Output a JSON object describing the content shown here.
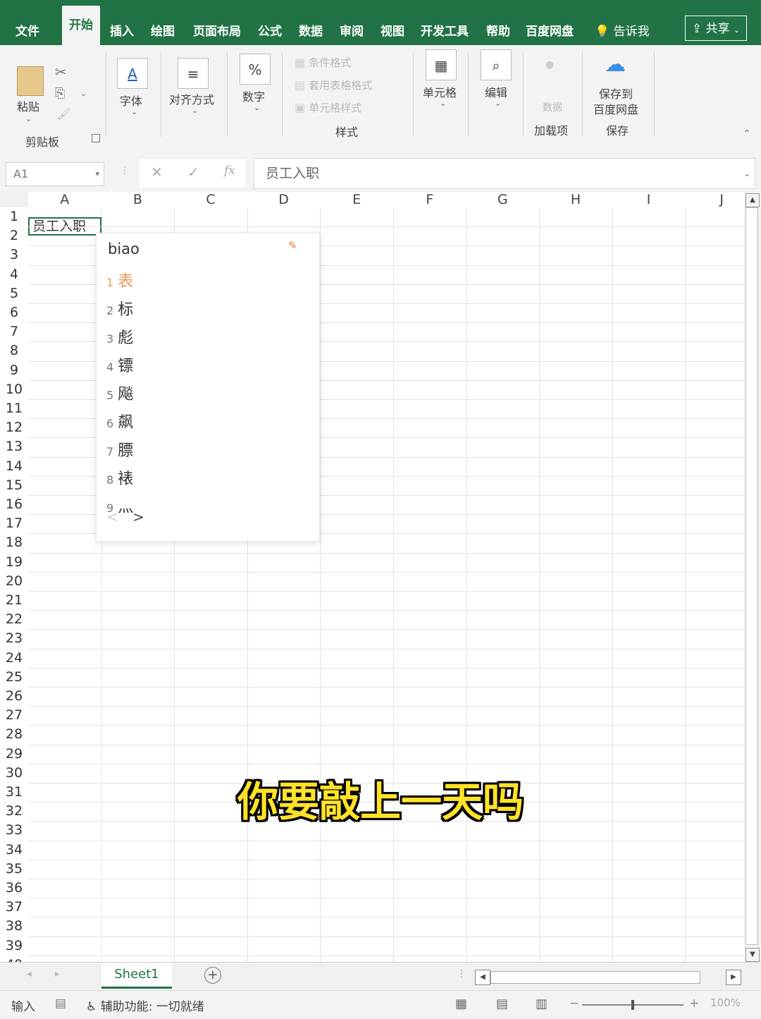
{
  "ribbon_tabs": {
    "file": "文件",
    "home": "开始",
    "insert": "插入",
    "draw": "绘图",
    "page_layout": "页面布局",
    "formulas": "公式",
    "data": "数据",
    "review": "审阅",
    "view": "视图",
    "developer": "开发工具",
    "help": "帮助",
    "baidu": "百度网盘",
    "tell_me": "告诉我",
    "share": "共享"
  },
  "ribbon": {
    "clipboard": {
      "paste": "粘贴",
      "group": "剪贴板"
    },
    "font": "字体",
    "alignment": "对齐方式",
    "number": "数字",
    "number_icon": "%",
    "styles": {
      "conditional": "条件格式",
      "table_format": "套用表格格式",
      "cell_styles": "单元格样式",
      "group": "样式"
    },
    "cells": "单元格",
    "editing": "编辑",
    "addins": {
      "item": "数据",
      "group": "加载项"
    },
    "save": {
      "line1": "保存到",
      "line2": "百度网盘",
      "group": "保存"
    }
  },
  "formula_bar": {
    "name_box": "A1",
    "cancel": "✕",
    "enter": "✓",
    "fx": "fx",
    "content": "员工入职"
  },
  "grid": {
    "columns": [
      "A",
      "B",
      "C",
      "D",
      "E",
      "F",
      "G",
      "H",
      "I",
      "J"
    ],
    "active_cell_text": "员工入职"
  },
  "ime": {
    "input": "biao",
    "candidates": [
      {
        "num": "1",
        "text": "表"
      },
      {
        "num": "2",
        "text": "标"
      },
      {
        "num": "3",
        "text": "彪"
      },
      {
        "num": "4",
        "text": "镖"
      },
      {
        "num": "5",
        "text": "飚"
      },
      {
        "num": "6",
        "text": "飙"
      },
      {
        "num": "7",
        "text": "膘"
      },
      {
        "num": "8",
        "text": "裱"
      },
      {
        "num": "9",
        "text": "灬"
      }
    ],
    "prev": "<",
    "next": ">"
  },
  "subtitle": "你要敲上一天吗",
  "sheets": {
    "active": "Sheet1",
    "add": "+"
  },
  "status": {
    "mode": "输入",
    "accessibility": "辅助功能: 一切就绪",
    "zoom": "100%"
  },
  "colors": {
    "excel_green": "#217346",
    "subtitle_yellow": "#ffe227",
    "ime_selected": "#e69a5c"
  }
}
